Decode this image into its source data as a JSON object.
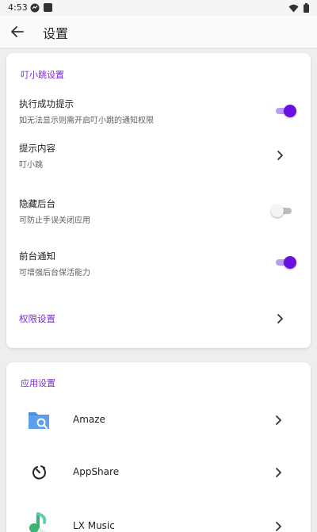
{
  "status": {
    "time": "4:53"
  },
  "appbar": {
    "title": "设置"
  },
  "section1": {
    "title": "叮小跳设置",
    "items": [
      {
        "title": "执行成功提示",
        "subtitle": "如无法显示则需开启叮小跳的通知权限",
        "control": "switch",
        "on": true
      },
      {
        "title": "提示内容",
        "subtitle": "叮小跳",
        "control": "chevron"
      },
      {
        "title": "隐藏后台",
        "subtitle": "可防止手误关闭应用",
        "control": "switch",
        "on": false
      },
      {
        "title": "前台通知",
        "subtitle": "可增强后台保活能力",
        "control": "switch",
        "on": true
      },
      {
        "title": "权限设置",
        "control": "chevron"
      }
    ]
  },
  "section2": {
    "title": "应用设置",
    "apps": [
      {
        "name": "Amaze",
        "icon": "folder-search-icon"
      },
      {
        "name": "AppShare",
        "icon": "appshare-icon"
      },
      {
        "name": "LX Music",
        "icon": "music-note-icon"
      }
    ]
  },
  "colors": {
    "accent": "#6a11e0",
    "section_title": "#7c2dd6"
  }
}
